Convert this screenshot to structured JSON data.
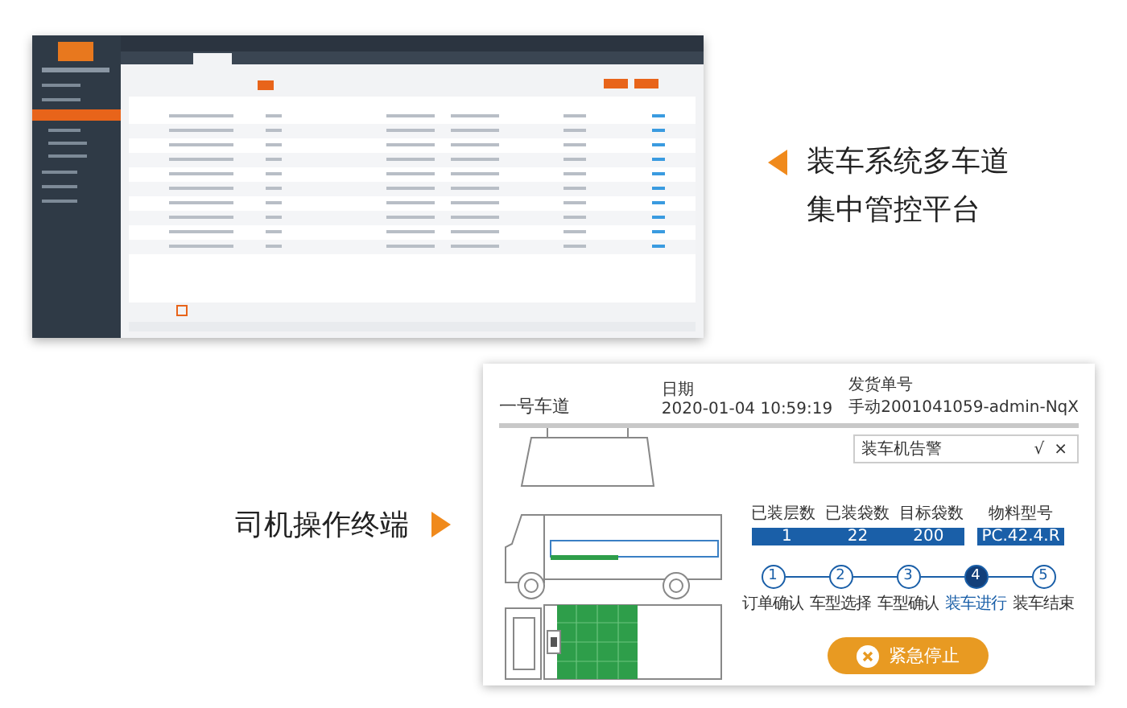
{
  "top_caption": {
    "lines": [
      "装车系统多车道",
      "集中管控平台"
    ]
  },
  "bottom_caption": "司机操作终端",
  "terminal": {
    "lane": "一号车道",
    "date_label": "日期",
    "date": "2020-01-04 10:59:19",
    "order_label": "发货单号",
    "order": "手动2001041059-admin-NqX",
    "alarm": {
      "text": "装车机告警",
      "confirm": "√",
      "close": "×"
    },
    "stats": [
      {
        "label": "已装层数",
        "value": "1"
      },
      {
        "label": "已装袋数",
        "value": "22"
      },
      {
        "label": "目标袋数",
        "value": "200"
      }
    ],
    "material": {
      "label": "物料型号",
      "value": "PC.42.4.R"
    },
    "steps": [
      {
        "number": "1",
        "label": "订单确认",
        "selected": false
      },
      {
        "number": "2",
        "label": "车型选择",
        "selected": false
      },
      {
        "number": "3",
        "label": "车型确认",
        "selected": false
      },
      {
        "number": "4",
        "label": "装车进行",
        "selected": true
      },
      {
        "number": "5",
        "label": "装车结束",
        "selected": false
      }
    ],
    "stop_button": {
      "label": "紧急停止"
    }
  }
}
